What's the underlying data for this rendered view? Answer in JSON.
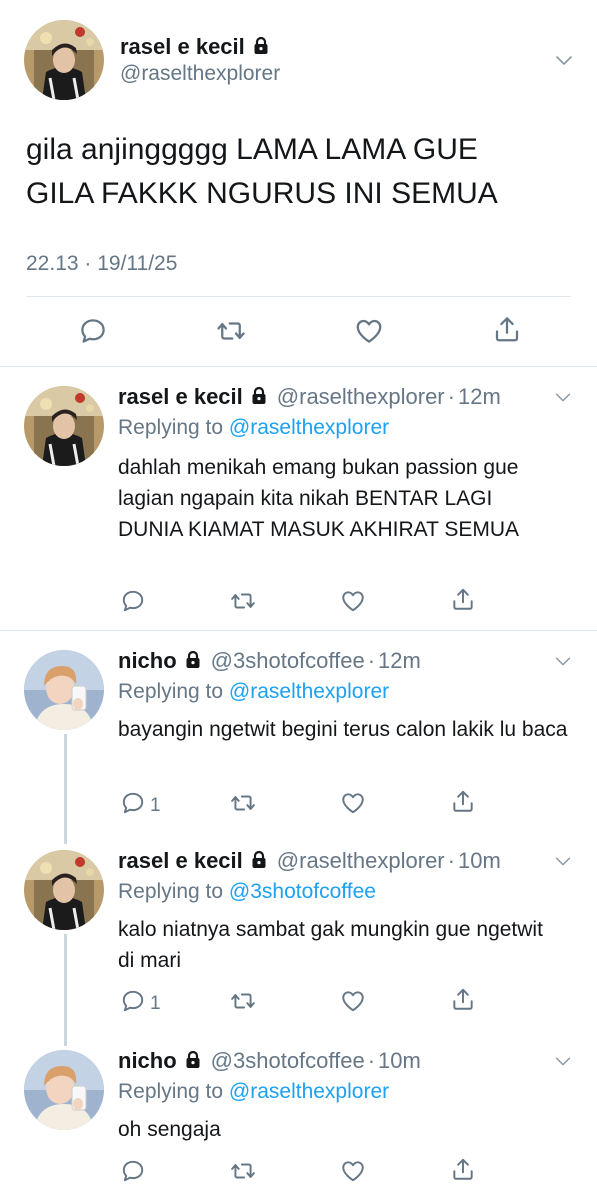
{
  "colors": {
    "text": "#14171a",
    "secondary": "#657786",
    "link": "#1da1f2",
    "divider": "#e1e8ed",
    "thread": "#ccd6dd"
  },
  "main_tweet": {
    "name": "rasel e kecil",
    "handle": "@raselthexplorer",
    "text": "gila anjinggggg LAMA LAMA GUE GILA FAKKK NGURUS INI SEMUA",
    "timestamp": "22.13 · 19/11/25",
    "icons": [
      "reply-icon",
      "retweet-icon",
      "like-icon",
      "share-icon"
    ]
  },
  "replies": [
    {
      "name": "rasel e kecil",
      "handle": "@raselthexplorer",
      "time": "12m",
      "replying_label": "Replying to ",
      "replying_to": "@raselthexplorer",
      "text": "dahlah menikah emang bukan passion gue lagian ngapain kita nikah BENTAR LAGI DUNIA KIAMAT MASUK AKHIRAT SEMUA",
      "reply_count": ""
    },
    {
      "name": "nicho",
      "handle": "@3shotofcoffee",
      "time": "12m",
      "replying_label": "Replying to ",
      "replying_to": "@raselthexplorer",
      "text": "bayangin ngetwit begini terus calon lakik lu baca",
      "reply_count": "1"
    },
    {
      "name": "rasel e kecil",
      "handle": "@raselthexplorer",
      "time": "10m",
      "replying_label": "Replying to ",
      "replying_to": "@3shotofcoffee",
      "text": "kalo niatnya sambat gak mungkin gue ngetwit di mari",
      "reply_count": "1"
    },
    {
      "name": "nicho",
      "handle": "@3shotofcoffee",
      "time": "10m",
      "replying_label": "Replying to ",
      "replying_to": "@raselthexplorer",
      "text": "oh sengaja",
      "reply_count": ""
    }
  ]
}
